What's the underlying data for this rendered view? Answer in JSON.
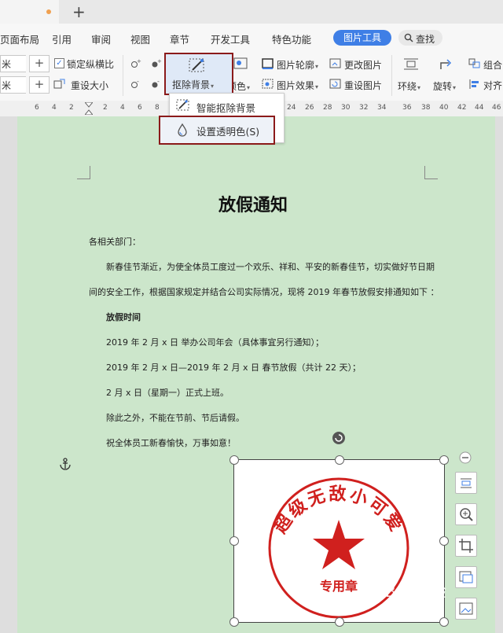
{
  "menubar": {
    "items": [
      "页面布局",
      "引用",
      "审阅",
      "视图",
      "章节",
      "开发工具",
      "特色功能"
    ],
    "picture_tools": "图片工具",
    "search_label": "查找"
  },
  "ribbon": {
    "width_unit": "米",
    "height_unit": "米",
    "lock_ratio": "锁定纵横比",
    "resize": "重设大小",
    "remove_background": "抠除背景",
    "color": "颜色",
    "picture_outline": "图片轮廓",
    "change_picture": "更改图片",
    "picture_effect": "图片效果",
    "reset_picture": "重设图片",
    "wrap": "环绕",
    "rotate": "旋转",
    "group": "组合",
    "align": "对齐"
  },
  "ruler": {
    "ticks": [
      "6",
      "4",
      "2",
      "2",
      "4",
      "6",
      "8",
      "24",
      "26",
      "28",
      "30",
      "32",
      "34",
      "36",
      "38",
      "40",
      "42",
      "44",
      "46"
    ]
  },
  "dropdown": {
    "smart_remove": "智能抠除背景",
    "set_transparent": "设置透明色(S)"
  },
  "document": {
    "title": "放假通知",
    "greeting": "各相关部门：",
    "para1": "新春佳节渐近，为使全体员工度过一个欢乐、祥和、平安的新春佳节，切实做好节日期",
    "para2": "间的安全工作，根据国家规定并结合公司实际情况，现将 2019 年春节放假安排通知如下 ：",
    "heading": "放假时间",
    "item1": "2019 年 2 月 x 日  举办公司年会（具体事宜另行通知）；",
    "item2": "2019 年 2 月 x 日—2019 年 2 月 x 日  春节放假（共计 22 天）；",
    "item3": "2 月 x 日（星期一）正式上班。",
    "item4": "除此之外，不能在节前、节后请假。",
    "item5": "祝全体员工新春愉快，万事如意！"
  },
  "stamp": {
    "arc_text": "超级无敌小可爱",
    "bottom_text": "专用章",
    "color": "#d0201e"
  },
  "watermark": "Bai 经验",
  "colors": {
    "accent": "#3f7fe6",
    "highlight_border": "#8b1a1a",
    "page_bg": "#cce6cb"
  }
}
